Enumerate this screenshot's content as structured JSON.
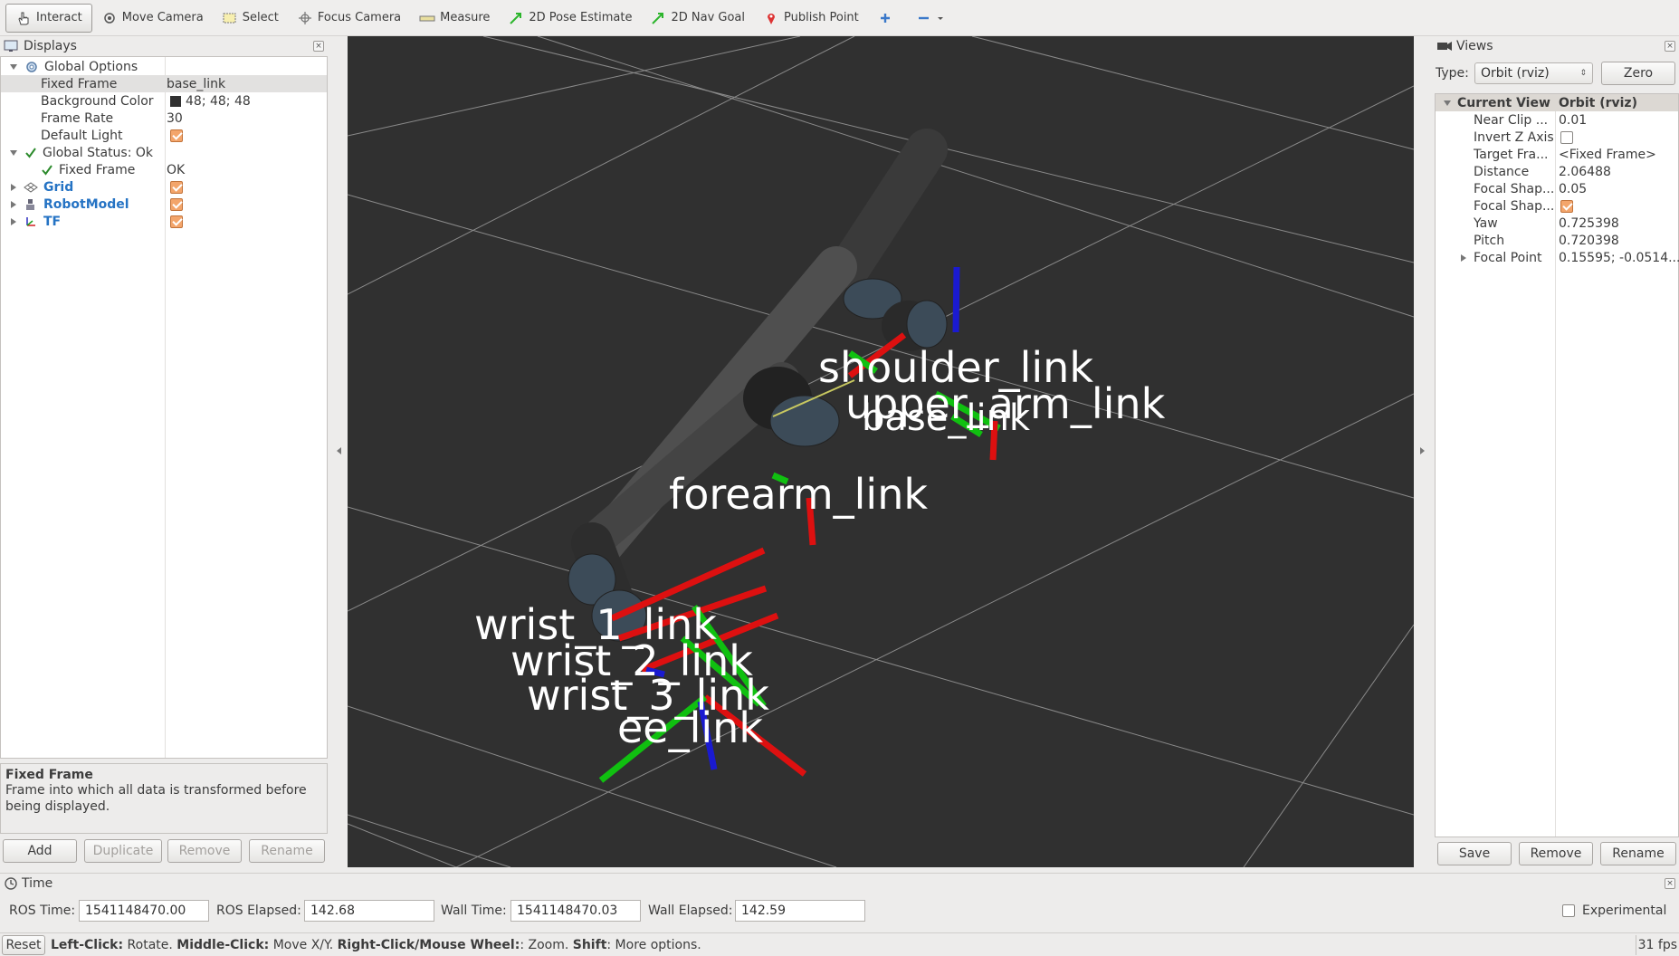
{
  "toolbar": {
    "interact": "Interact",
    "move_camera": "Move Camera",
    "select": "Select",
    "focus_camera": "Focus Camera",
    "measure": "Measure",
    "pose_estimate": "2D Pose Estimate",
    "nav_goal": "2D Nav Goal",
    "publish_point": "Publish Point"
  },
  "displays": {
    "title": "Displays",
    "rows": {
      "global_options": "Global Options",
      "fixed_frame_label": "Fixed Frame",
      "fixed_frame_value": "base_link",
      "background_color_label": "Background Color",
      "background_color_value": "48; 48; 48",
      "frame_rate_label": "Frame Rate",
      "frame_rate_value": "30",
      "default_light_label": "Default Light",
      "global_status": "Global Status: Ok",
      "status_fixed_frame_label": "Fixed Frame",
      "status_fixed_frame_value": "OK",
      "grid": "Grid",
      "robot_model": "RobotModel",
      "tf": "TF"
    },
    "help_title": "Fixed Frame",
    "help_text": "Frame into which all data is transformed before being displayed.",
    "buttons": {
      "add": "Add",
      "duplicate": "Duplicate",
      "remove": "Remove",
      "rename": "Rename"
    }
  },
  "scene": {
    "labels": {
      "shoulder": "shoulder_link",
      "upper_arm": "upper_arm_link",
      "base": "base_link",
      "forearm": "forearm_link",
      "wrist1": "wrist_1_link",
      "wrist2": "wrist_2_link",
      "wrist3": "wrist_3_link",
      "ee": "ee_link"
    },
    "background": "#303030",
    "axis_colors": {
      "x": "#e01010",
      "y": "#10c010",
      "z": "#1010c8"
    }
  },
  "views": {
    "title": "Views",
    "type_label": "Type:",
    "type_value": "Orbit (rviz)",
    "zero": "Zero",
    "header_name": "Current View",
    "header_value": "Orbit (rviz)",
    "rows": [
      {
        "name": "Near Clip ...",
        "value": "0.01"
      },
      {
        "name": "Invert Z Axis",
        "value": ""
      },
      {
        "name": "Target Fra...",
        "value": "<Fixed Frame>"
      },
      {
        "name": "Distance",
        "value": "2.06488"
      },
      {
        "name": "Focal Shap...",
        "value": "0.05"
      },
      {
        "name": "Focal Shap...",
        "value": ""
      },
      {
        "name": "Yaw",
        "value": "0.725398"
      },
      {
        "name": "Pitch",
        "value": "0.720398"
      },
      {
        "name": "Focal Point",
        "value": "0.15595; -0.0514..."
      }
    ],
    "buttons": {
      "save": "Save",
      "remove": "Remove",
      "rename": "Rename"
    }
  },
  "time": {
    "title": "Time",
    "ros_time_label": "ROS Time:",
    "ros_time": "1541148470.00",
    "ros_elapsed_label": "ROS Elapsed:",
    "ros_elapsed": "142.68",
    "wall_time_label": "Wall Time:",
    "wall_time": "1541148470.03",
    "wall_elapsed_label": "Wall Elapsed:",
    "wall_elapsed": "142.59",
    "experimental": "Experimental"
  },
  "status": {
    "reset": "Reset",
    "left_click": "Left-Click:",
    "left_click_desc": " Rotate. ",
    "middle_click": "Middle-Click:",
    "middle_click_desc": " Move X/Y. ",
    "right_click": "Right-Click/Mouse Wheel:",
    "right_click_desc": ": Zoom. ",
    "shift": "Shift",
    "shift_desc": ": More options.",
    "fps": "31 fps"
  }
}
